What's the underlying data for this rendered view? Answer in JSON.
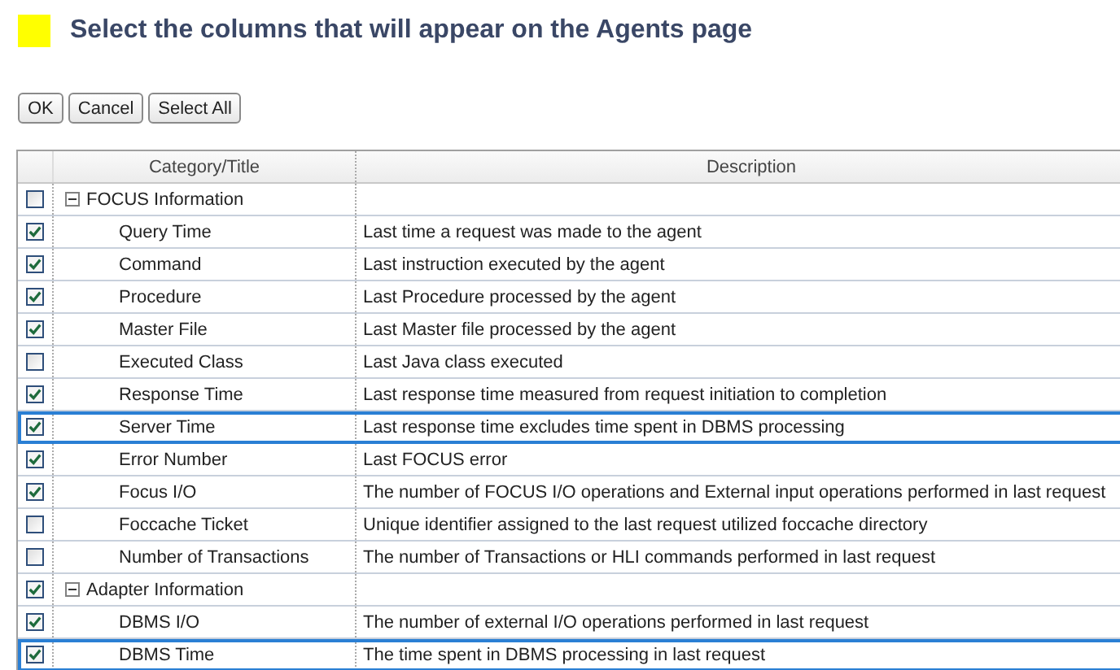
{
  "heading": "Select the columns that will appear on the Agents page",
  "buttons": [
    "OK",
    "Cancel",
    "Select All"
  ],
  "table": {
    "columns": [
      "Category/Title",
      "Description"
    ],
    "groups": [
      {
        "title": "FOCUS Information",
        "checked": false,
        "expanded": true,
        "selected": false,
        "children": [
          {
            "title": "Query Time",
            "description": "Last time a request was made to the agent",
            "checked": true,
            "selected": false
          },
          {
            "title": "Command",
            "description": "Last instruction executed by the agent",
            "checked": true,
            "selected": false
          },
          {
            "title": "Procedure",
            "description": "Last Procedure processed by the agent",
            "checked": true,
            "selected": false
          },
          {
            "title": "Master File",
            "description": "Last Master file processed by the agent",
            "checked": true,
            "selected": false
          },
          {
            "title": "Executed Class",
            "description": "Last Java class executed",
            "checked": false,
            "selected": false
          },
          {
            "title": "Response Time",
            "description": "Last response time measured from request initiation to completion",
            "checked": true,
            "selected": false
          },
          {
            "title": "Server Time",
            "description": "Last response time excludes time spent in DBMS processing",
            "checked": true,
            "selected": true
          },
          {
            "title": "Error Number",
            "description": "Last FOCUS error",
            "checked": true,
            "selected": false
          },
          {
            "title": "Focus I/O",
            "description": "The number of FOCUS I/O operations and External input operations performed in last request",
            "checked": true,
            "selected": false
          },
          {
            "title": "Foccache Ticket",
            "description": "Unique identifier assigned to the last request utilized foccache directory",
            "checked": false,
            "selected": false
          },
          {
            "title": "Number of Transactions",
            "description": "The number of Transactions or HLI commands performed in last request",
            "checked": false,
            "selected": false
          }
        ]
      },
      {
        "title": "Adapter Information",
        "checked": true,
        "expanded": true,
        "selected": false,
        "children": [
          {
            "title": "DBMS I/O",
            "description": "The number of external I/O operations performed in last request",
            "checked": true,
            "selected": false
          },
          {
            "title": "DBMS Time",
            "description": "The time spent in DBMS processing in last request",
            "checked": true,
            "selected": true
          }
        ]
      }
    ]
  }
}
